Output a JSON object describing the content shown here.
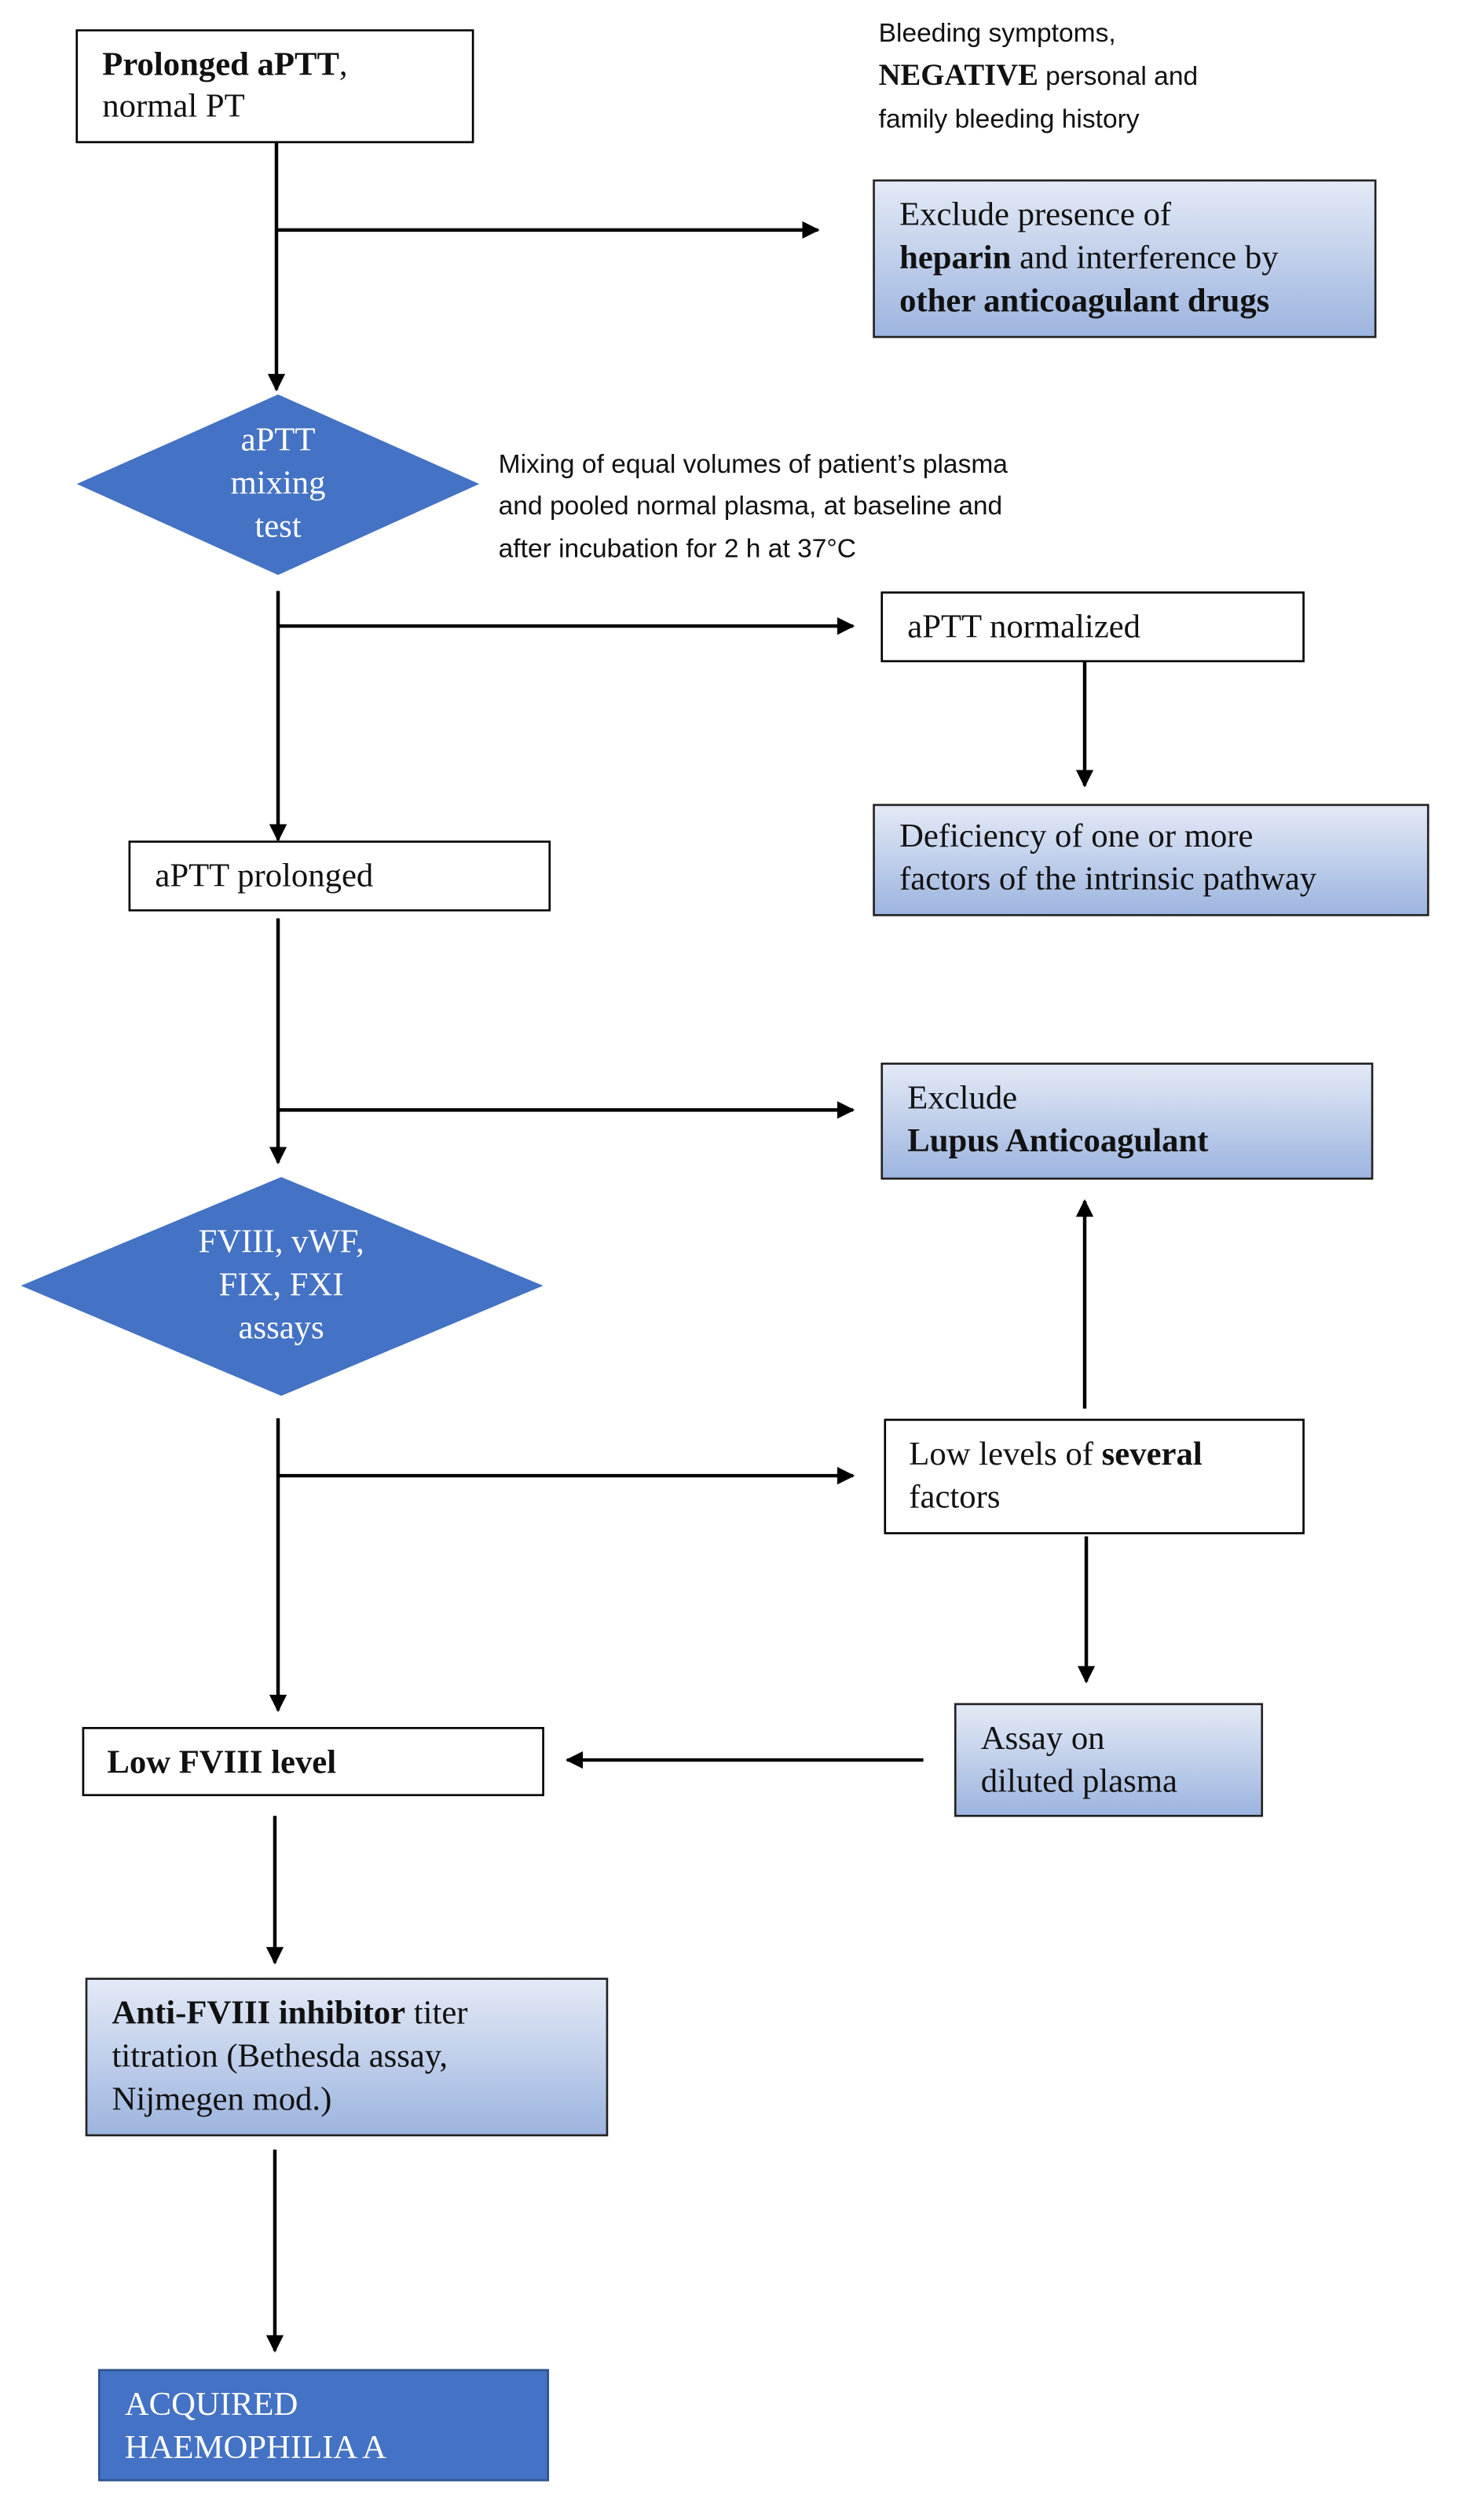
{
  "colors": {
    "diamond": "#4472C4",
    "final_box": "#4472C4",
    "gradient_top": "#e4eaf6",
    "gradient_bottom": "#9cb4df"
  },
  "start": {
    "bold": "Prolonged aPTT",
    "rest": ",",
    "line2": "normal PT"
  },
  "note_top": {
    "line1": "Bleeding symptoms,",
    "line2_bold": "NEGATIVE",
    "line2_rest": " personal and",
    "line3": "family bleeding history"
  },
  "exclude_heparin": {
    "line1": "Exclude presence of",
    "line2_bold": "heparin",
    "line2_rest": " and interference by",
    "line3_bold": "other anticoagulant drugs"
  },
  "mixing_test": {
    "line1": "aPTT",
    "line2": "mixing",
    "line3": "test"
  },
  "mixing_note": {
    "line1": "Mixing of equal volumes of patient’s plasma",
    "line2": "and pooled normal plasma, at baseline and",
    "line3": "after incubation for 2 h at 37°C"
  },
  "aptt_normalized": "aPTT normalized",
  "deficiency": {
    "line1": "Deficiency of one or more",
    "line2": "factors of the intrinsic pathway"
  },
  "aptt_prolonged": "aPTT prolonged",
  "exclude_lupus": {
    "line1": "Exclude",
    "line2_bold": "Lupus Anticoagulant"
  },
  "assays": {
    "line1": "FVIII, vWF,",
    "line2": "FIX, FXI",
    "line3": "assays"
  },
  "low_several": {
    "line1": "Low levels of ",
    "line1_bold": "several",
    "line2": "factors"
  },
  "diluted": {
    "line1": "Assay on",
    "line2": "diluted plasma"
  },
  "low_fviii": "Low FVIII level",
  "inhibitor": {
    "line1_bold": "Anti-FVIII inhibitor",
    "line1_rest": " titer",
    "line2": "titration (Bethesda assay,",
    "line3": "Nijmegen mod.)"
  },
  "result": {
    "line1": "ACQUIRED",
    "line2": "HAEMOPHILIA A"
  }
}
